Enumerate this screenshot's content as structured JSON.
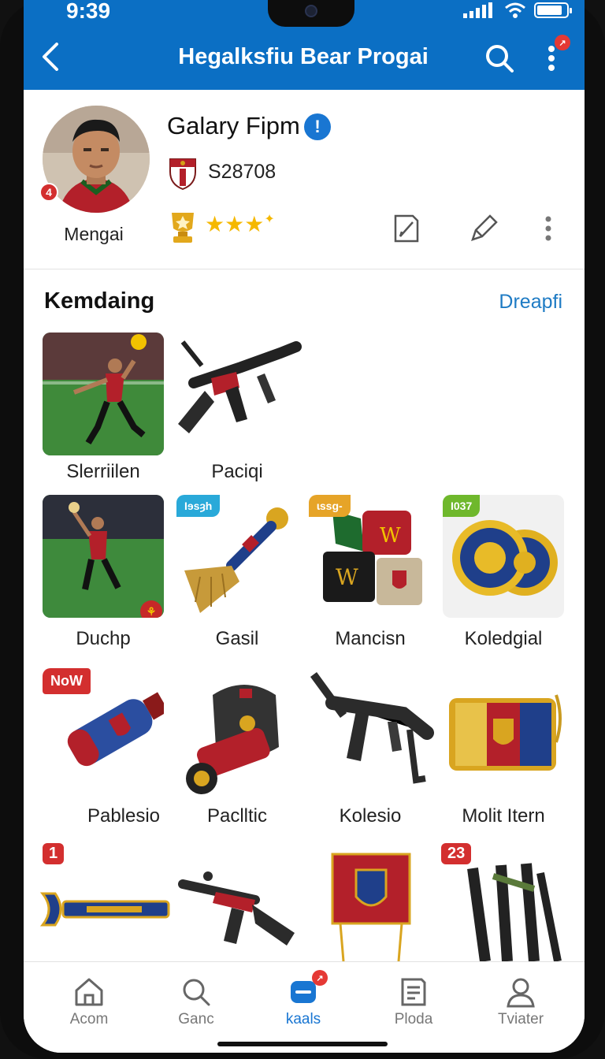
{
  "status_bar": {
    "time": "9:39",
    "battery_level": 0.85
  },
  "header": {
    "title": "Hegalksfiu Bear Progai",
    "notification_badge": "↗"
  },
  "profile": {
    "avatar_badge": "4",
    "avatar_name": "Mengai",
    "name": "Galary Fipm",
    "verified_glyph": "!",
    "id": "S28708",
    "rating_stars": 3
  },
  "section": {
    "title": "Kemdaing",
    "link": "Dreapfi"
  },
  "items": [
    {
      "label": "Slerriilen"
    },
    {
      "label": "Paciqi"
    },
    {
      "label": "Duchp"
    },
    {
      "label": "Gasil",
      "tag": "Ɩɘsȝh"
    },
    {
      "label": "Mancisn",
      "tag": "ɩssɡ-"
    },
    {
      "label": "Koledgial",
      "tag": "Ɩ037"
    },
    {
      "label": "Pablesio",
      "tag": "NoW"
    },
    {
      "label": "Paclltic"
    },
    {
      "label": "Kolesio"
    },
    {
      "label": "Molit  Itern"
    },
    {
      "badge": "1"
    },
    {
      "badge": "23"
    }
  ],
  "bottom_nav": [
    {
      "label": "Acom",
      "icon": "home-icon"
    },
    {
      "label": "Ganc",
      "icon": "search-icon"
    },
    {
      "label": "kaals",
      "icon": "chat-icon",
      "badge": "↗",
      "active": true
    },
    {
      "label": "Ploda",
      "icon": "document-icon"
    },
    {
      "label": "Tviater",
      "icon": "person-icon"
    }
  ],
  "colors": {
    "primary": "#0b6fc4",
    "accent": "#1976d2",
    "badge": "#e53935",
    "star": "#f5b800"
  }
}
